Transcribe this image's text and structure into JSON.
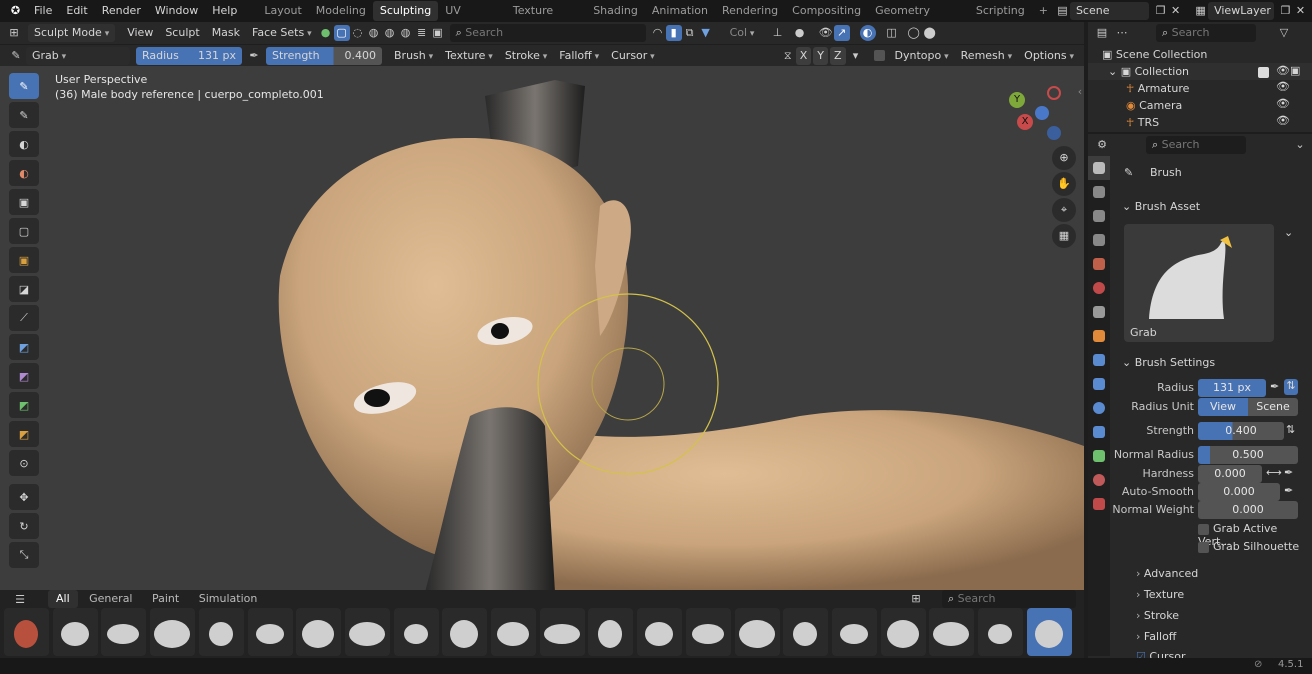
{
  "topbar": {
    "menus": [
      "File",
      "Edit",
      "Render",
      "Window",
      "Help"
    ],
    "workspaces": [
      "Layout",
      "Modeling",
      "Sculpting",
      "UV Editing",
      "Texture Paint",
      "Shading",
      "Animation",
      "Rendering",
      "Compositing",
      "Geometry Nodes",
      "Scripting"
    ],
    "active_workspace": "Sculpting",
    "scene": "Scene",
    "viewlayer": "ViewLayer",
    "add_tab": "+"
  },
  "header2": {
    "mode": "Sculpt Mode",
    "menus": [
      "View",
      "Sculpt",
      "Mask",
      "Face Sets"
    ],
    "search_placeholder": "Search",
    "col_label": "Col"
  },
  "header3": {
    "brush": "Grab",
    "radius_label": "Radius",
    "radius_value": "131 px",
    "strength_label": "Strength",
    "strength_value": "0.400",
    "menus": [
      "Brush",
      "Texture",
      "Stroke",
      "Falloff",
      "Cursor"
    ],
    "axes": [
      "X",
      "Y",
      "Z"
    ],
    "dyntopo": "Dyntopo",
    "remesh": "Remesh",
    "options": "Options"
  },
  "viewport": {
    "perspective": "User Perspective",
    "object_info": "(36) Male body reference | cuerpo_completo.001",
    "gizmo": {
      "y": "Y",
      "x": "X",
      "z": "Z"
    }
  },
  "assetbar": {
    "tabs": [
      "All",
      "General",
      "Paint",
      "Simulation"
    ],
    "active_tab": "All",
    "search_placeholder": "Search"
  },
  "outliner": {
    "search_placeholder": "Search",
    "root": "Scene Collection",
    "collection": "Collection",
    "items": [
      "Armature",
      "Camera",
      "TRS"
    ]
  },
  "properties": {
    "search_placeholder": "Search",
    "title": "Brush",
    "asset_section": "Brush Asset",
    "asset_name": "Grab",
    "settings_section": "Brush Settings",
    "rows": [
      {
        "label": "Radius",
        "value": "131 px",
        "fill": 1.0
      },
      {
        "label": "Strength",
        "value": "0.400",
        "fill": 0.4
      },
      {
        "label": "Normal Radius",
        "value": "0.500",
        "fill": 0.12
      },
      {
        "label": "Hardness",
        "value": "0.000",
        "fill": 0
      },
      {
        "label": "Auto-Smooth",
        "value": "0.000",
        "fill": 0
      },
      {
        "label": "Normal Weight",
        "value": "0.000",
        "fill": 0
      }
    ],
    "radius_unit_label": "Radius Unit",
    "radius_unit_view": "View",
    "radius_unit_scene": "Scene",
    "grab_active": "Grab Active Vert...",
    "grab_silhouette": "Grab Silhouette",
    "sections": [
      "Advanced",
      "Texture",
      "Stroke",
      "Falloff",
      "Cursor"
    ]
  },
  "statusbar": {
    "version": "4.5.1"
  },
  "colors": {
    "accent": "#4772b3",
    "skin": "#c9a47c",
    "viewport_bg": "#3d3d3d"
  }
}
